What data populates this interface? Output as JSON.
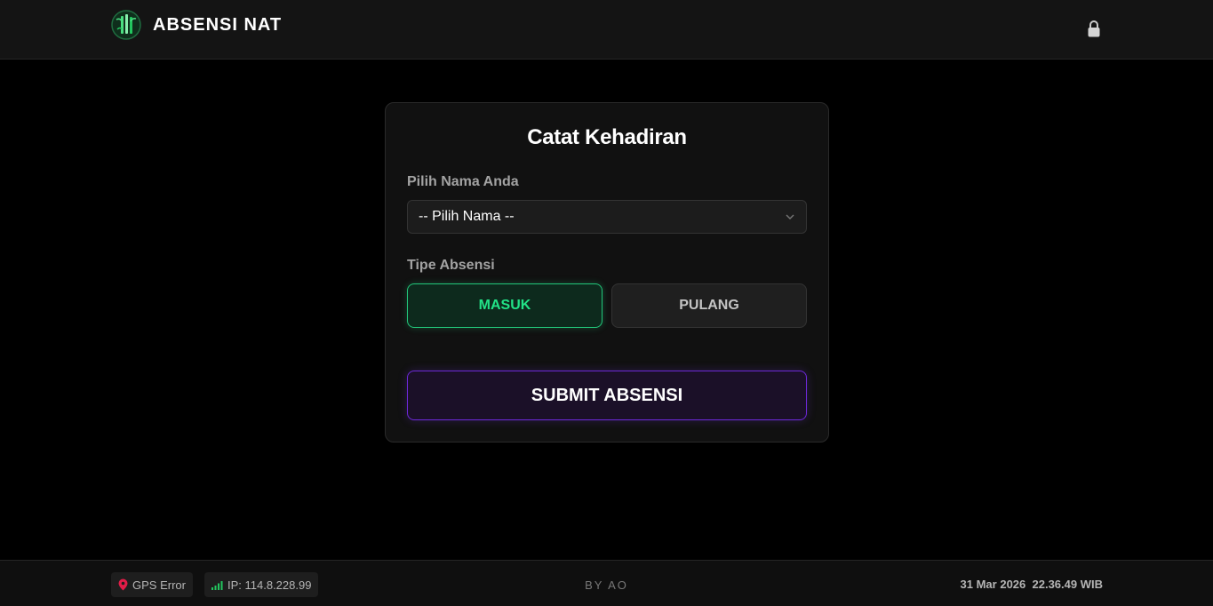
{
  "app": {
    "title": "ABSENSI NAT",
    "logo_icon": "bamboo-logo-icon",
    "lock_icon": "lock-icon"
  },
  "form": {
    "title": "Catat Kehadiran",
    "name_label": "Pilih Nama Anda",
    "name_select": {
      "value": "-- Pilih Nama --",
      "options": [
        "-- Pilih Nama --"
      ]
    },
    "type_label": "Tipe Absensi",
    "types": [
      {
        "label": "MASUK",
        "selected": true
      },
      {
        "label": "PULANG",
        "selected": false
      }
    ],
    "submit_label": "SUBMIT ABSENSI"
  },
  "footer": {
    "gps_status": "GPS Error",
    "ip_text": "IP: 114.8.228.99",
    "credit": "BY AO",
    "date": "31 Mar 2026",
    "time": "22.36.49 WIB"
  },
  "colors": {
    "background": "#000000",
    "accent_green": "#22e287",
    "accent_purple": "#6d28d9",
    "gps_error_red": "#e11d48"
  }
}
